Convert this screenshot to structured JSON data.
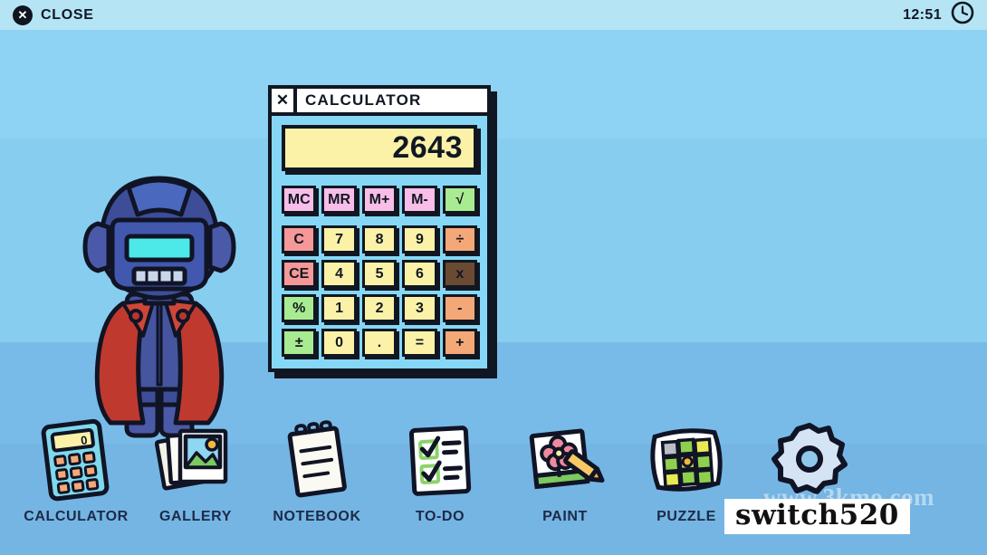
{
  "topbar": {
    "close_icon": "x-circle-icon",
    "close_label": "CLOSE",
    "time": "12:51",
    "clock_icon": "clock-icon"
  },
  "calculator": {
    "title": "CALCULATOR",
    "close_label": "✕",
    "display_value": "2643",
    "memory_row": [
      {
        "label": "MC",
        "style": "mem"
      },
      {
        "label": "MR",
        "style": "mem"
      },
      {
        "label": "M+",
        "style": "mem"
      },
      {
        "label": "M-",
        "style": "mem"
      },
      {
        "label": "√",
        "style": "green"
      }
    ],
    "keypad": [
      [
        {
          "label": "C",
          "style": "red"
        },
        {
          "label": "7",
          "style": "num"
        },
        {
          "label": "8",
          "style": "num"
        },
        {
          "label": "9",
          "style": "num"
        },
        {
          "label": "÷",
          "style": "orange"
        }
      ],
      [
        {
          "label": "CE",
          "style": "red"
        },
        {
          "label": "4",
          "style": "num"
        },
        {
          "label": "5",
          "style": "num"
        },
        {
          "label": "6",
          "style": "num"
        },
        {
          "label": "x",
          "style": "dark"
        }
      ],
      [
        {
          "label": "%",
          "style": "green"
        },
        {
          "label": "1",
          "style": "num"
        },
        {
          "label": "2",
          "style": "num"
        },
        {
          "label": "3",
          "style": "num"
        },
        {
          "label": "-",
          "style": "orange"
        }
      ],
      [
        {
          "label": "±",
          "style": "green"
        },
        {
          "label": "0",
          "style": "num"
        },
        {
          "label": ".",
          "style": "num"
        },
        {
          "label": "=",
          "style": "num"
        },
        {
          "label": "+",
          "style": "orange"
        }
      ]
    ]
  },
  "character": {
    "name": "robot-avatar",
    "visor_color": "#4de8e8",
    "coat_color": "#c0392f",
    "body_color": "#3f4f9e"
  },
  "dock": {
    "items": [
      {
        "id": "calculator",
        "label": "CALCULATOR",
        "icon": "calculator-icon",
        "screen_value": "0"
      },
      {
        "id": "gallery",
        "label": "GALLERY",
        "icon": "photos-icon"
      },
      {
        "id": "notebook",
        "label": "NOTEBOOK",
        "icon": "notebook-icon"
      },
      {
        "id": "todo",
        "label": "TO-DO",
        "icon": "checklist-icon"
      },
      {
        "id": "paint",
        "label": "PAINT",
        "icon": "paint-icon"
      },
      {
        "id": "puzzle",
        "label": "PUZZLE",
        "icon": "puzzle-grid-icon"
      },
      {
        "id": "settings",
        "label": "",
        "icon": "gear-icon"
      }
    ]
  },
  "watermarks": {
    "faint": "www.3kmo.com",
    "box": "switch520"
  },
  "colors": {
    "background_top": "#8ed3f3",
    "background_bottom": "#74b5e4",
    "topbar": "#b5e4f5",
    "ink": "#111722",
    "display_yellow": "#fbf2a8",
    "key_pink": "#f8bde8",
    "key_green": "#a9eb90",
    "key_red": "#f59897",
    "key_orange": "#f5a877",
    "key_dark": "#6b4a33",
    "label_navy": "#1d2a46"
  }
}
